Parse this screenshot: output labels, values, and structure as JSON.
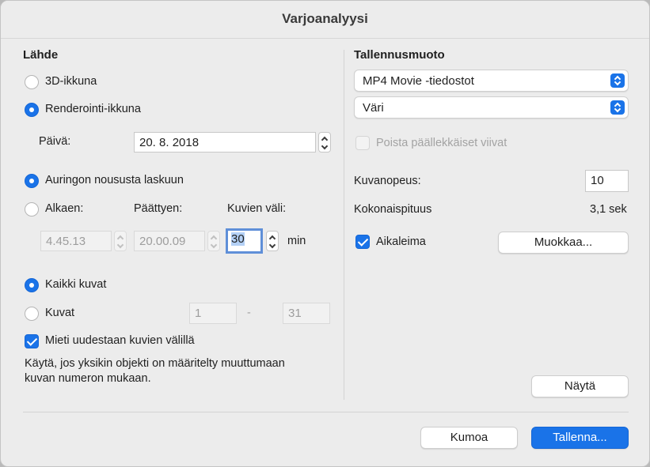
{
  "window": {
    "title": "Varjoanalyysi"
  },
  "source": {
    "heading": "Lähde",
    "option_3d": "3D-ikkuna",
    "option_render": "Renderointi-ikkuna",
    "date_label": "Päivä:",
    "date_value": "20.  8. 2018"
  },
  "time": {
    "option_sunrise": "Auringon noususta laskuun",
    "option_from": "Alkaen:",
    "end_label": "Päättyen:",
    "interval_label": "Kuvien väli:",
    "start_value": "4.45.13",
    "end_value": "20.00.09",
    "interval_value": "30",
    "interval_unit": "min"
  },
  "frames": {
    "option_all": "Kaikki kuvat",
    "option_range": "Kuvat",
    "range_from": "1",
    "range_sep": "-",
    "range_to": "31",
    "recalc_label": "Mieti uudestaan kuvien välillä",
    "help_line1": "Käytä, jos yksikin objekti on määritelty  muuttumaan",
    "help_line2": "kuvan numeron mukaan."
  },
  "output": {
    "heading": "Tallennusmuoto",
    "format_value": "MP4 Movie -tiedostot",
    "color_value": "Väri",
    "remove_overlap_label": "Poista päällekkäiset viivat",
    "frame_rate_label": "Kuvanopeus:",
    "frame_rate_value": "10",
    "total_length_label": "Kokonaispituus",
    "total_length_value": "3,1 sek",
    "timestamp_label": "Aikaleima",
    "edit_button": "Muokkaa...",
    "preview_button": "Näytä"
  },
  "footer": {
    "cancel_button": "Kumoa",
    "save_button": "Tallenna..."
  },
  "colors": {
    "accent": "#1a73e8",
    "window_bg": "#ececec"
  },
  "icons": [
    "radio-icon",
    "checkbox-icon",
    "stepper-icon",
    "popup-arrows-icon"
  ]
}
